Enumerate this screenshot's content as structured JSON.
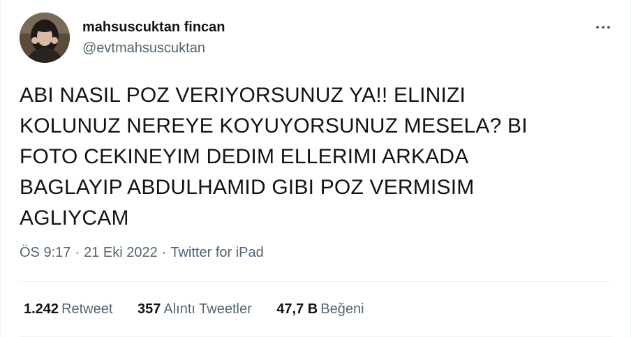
{
  "author": {
    "display_name": "mahsuscuktan fincan",
    "handle": "@evtmahsuscuktan"
  },
  "tweet": {
    "lines": [
      "ABI NASIL POZ VERIYORSUNUZ YA!! ELINIZI",
      "KOLUNUZ NEREYE KOYUYORSUNUZ MESELA? BI",
      "FOTO CEKINEYIM DEDIM ELLERIMI ARKADA",
      "BAGLAYIP ABDULHAMID GIBI POZ VERMISIM",
      "AGLIYCAM"
    ],
    "time": "ÖS 9:17",
    "date": "21 Eki 2022",
    "source": "Twitter for iPad",
    "separator": "·"
  },
  "stats": {
    "retweets_count": "1.242",
    "retweets_label": "Retweet",
    "quotes_count": "357",
    "quotes_label": "Alıntı Tweetler",
    "likes_count": "47,7 B",
    "likes_label": "Beğeni"
  },
  "icons": {
    "more": "more-horizontal-icon"
  },
  "colors": {
    "text_primary": "#0f1419",
    "text_secondary": "#536471",
    "divider": "#eff3f4"
  }
}
